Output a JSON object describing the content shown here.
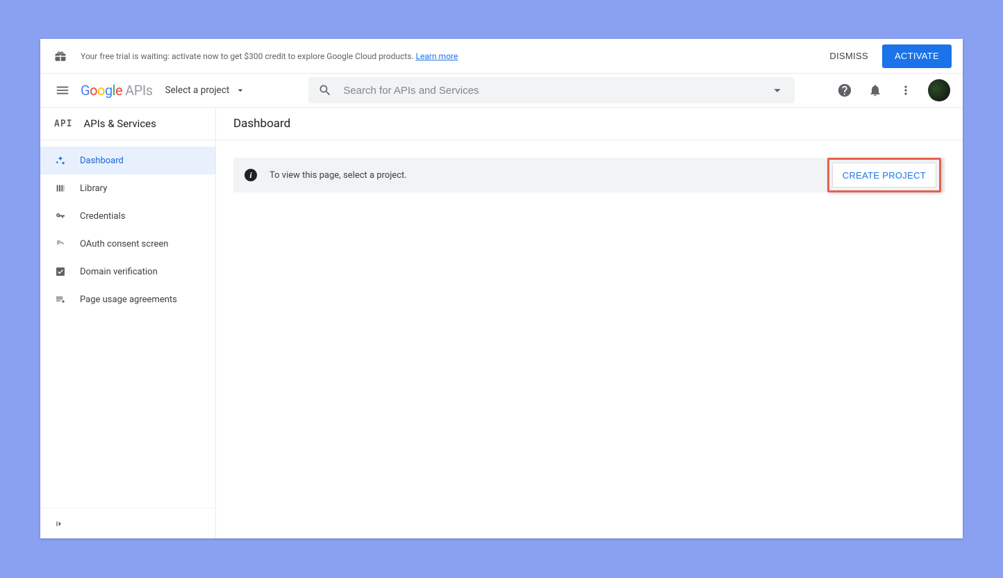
{
  "banner": {
    "text": "Your free trial is waiting: activate now to get $300 credit to explore Google Cloud products. ",
    "learn_more": "Learn more",
    "dismiss": "DISMISS",
    "activate": "ACTIVATE"
  },
  "topbar": {
    "logo_text_apis": "APIs",
    "project_label": "Select a project",
    "search_placeholder": "Search for APIs and Services"
  },
  "sidebar": {
    "title": "APIs & Services",
    "items": [
      {
        "label": "Dashboard"
      },
      {
        "label": "Library"
      },
      {
        "label": "Credentials"
      },
      {
        "label": "OAuth consent screen"
      },
      {
        "label": "Domain verification"
      },
      {
        "label": "Page usage agreements"
      }
    ]
  },
  "main": {
    "title": "Dashboard",
    "alert_text": "To view this page, select a project.",
    "create_project": "CREATE PROJECT"
  }
}
